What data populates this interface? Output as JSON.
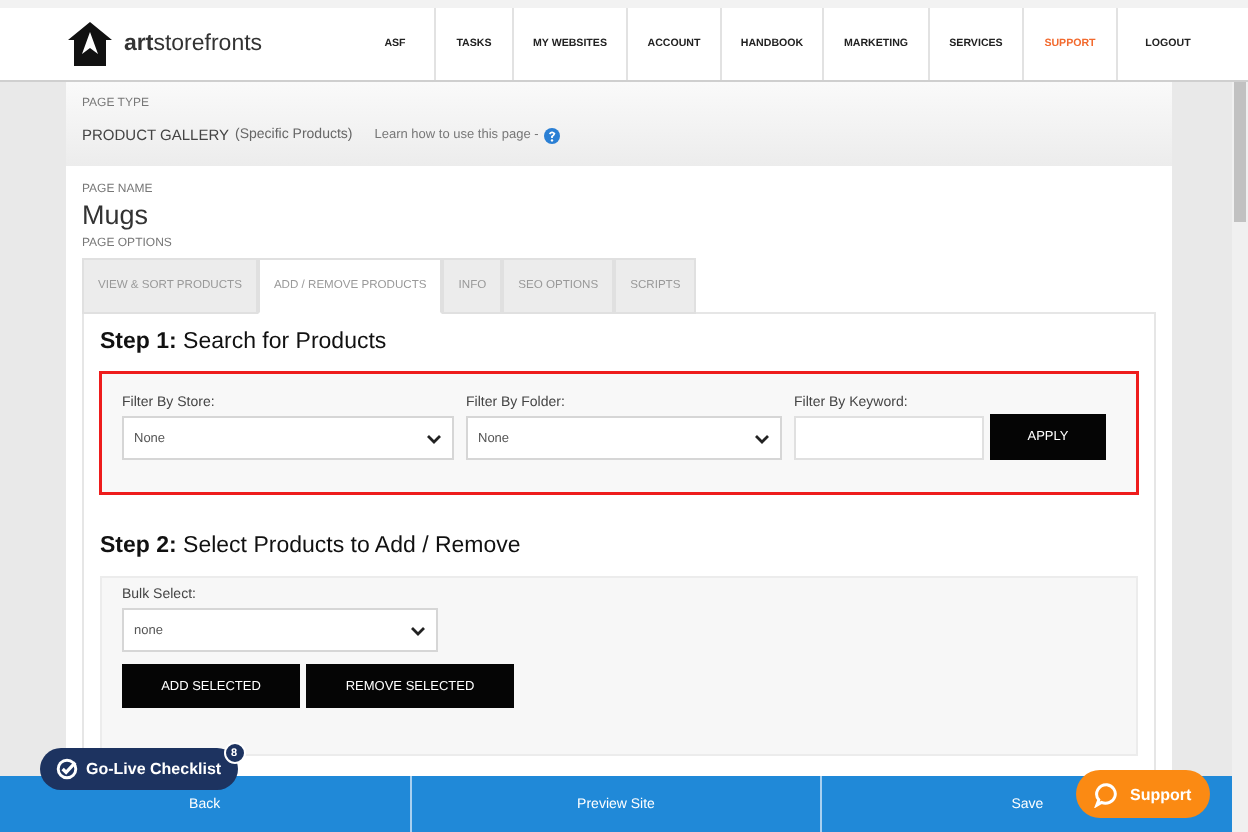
{
  "header": {
    "logo": "**art**storefronts",
    "nav": [
      {
        "label": "ASF",
        "highlighted": false
      },
      {
        "label": "TASKS",
        "highlighted": false
      },
      {
        "label": "MY WEBSITES",
        "highlighted": false
      },
      {
        "label": "ACCOUNT",
        "highlighted": false
      },
      {
        "label": "HANDBOOK",
        "highlighted": false
      },
      {
        "label": "MARKETING",
        "highlighted": false
      },
      {
        "label": "SERVICES",
        "highlighted": false
      },
      {
        "label": "SUPPORT",
        "highlighted": true
      },
      {
        "label": "LOGOUT",
        "highlighted": false
      }
    ]
  },
  "page_type": {
    "label": "PAGE TYPE",
    "value": "PRODUCT GALLERY",
    "detail": "(Specific Products)",
    "help_link": "Learn how to use this page -"
  },
  "page_name": {
    "label": "PAGE NAME",
    "value": "Mugs"
  },
  "page_options": {
    "label": "PAGE OPTIONS",
    "tabs": [
      {
        "label": "VIEW & SORT PRODUCTS",
        "selected": false
      },
      {
        "label": "ADD / REMOVE PRODUCTS",
        "selected": true
      },
      {
        "label": "INFO",
        "selected": false
      },
      {
        "label": "SEO OPTIONS",
        "selected": false
      },
      {
        "label": "SCRIPTS",
        "selected": false
      }
    ]
  },
  "step1": {
    "title": "**Step 1:** Search for Products",
    "filters": [
      {
        "kind": "select",
        "label": "Filter By Store:",
        "value": "None"
      },
      {
        "kind": "select",
        "label": "Filter By Folder:",
        "value": "None"
      },
      {
        "kind": "text",
        "label": "Filter By Keyword:"
      }
    ],
    "apply": "APPLY"
  },
  "step2": {
    "title": "**Step 2:** Select Products to Add / Remove",
    "bulk_label": "Bulk Select:",
    "bulk_value": "none",
    "buttons": [
      "ADD SELECTED",
      "REMOVE SELECTED"
    ]
  },
  "footer": {
    "buttons": [
      "Back",
      "Preview Site",
      "Save"
    ]
  },
  "checklist": {
    "label": "Go-Live Checklist",
    "count": "8"
  },
  "support": {
    "label": "Support"
  }
}
